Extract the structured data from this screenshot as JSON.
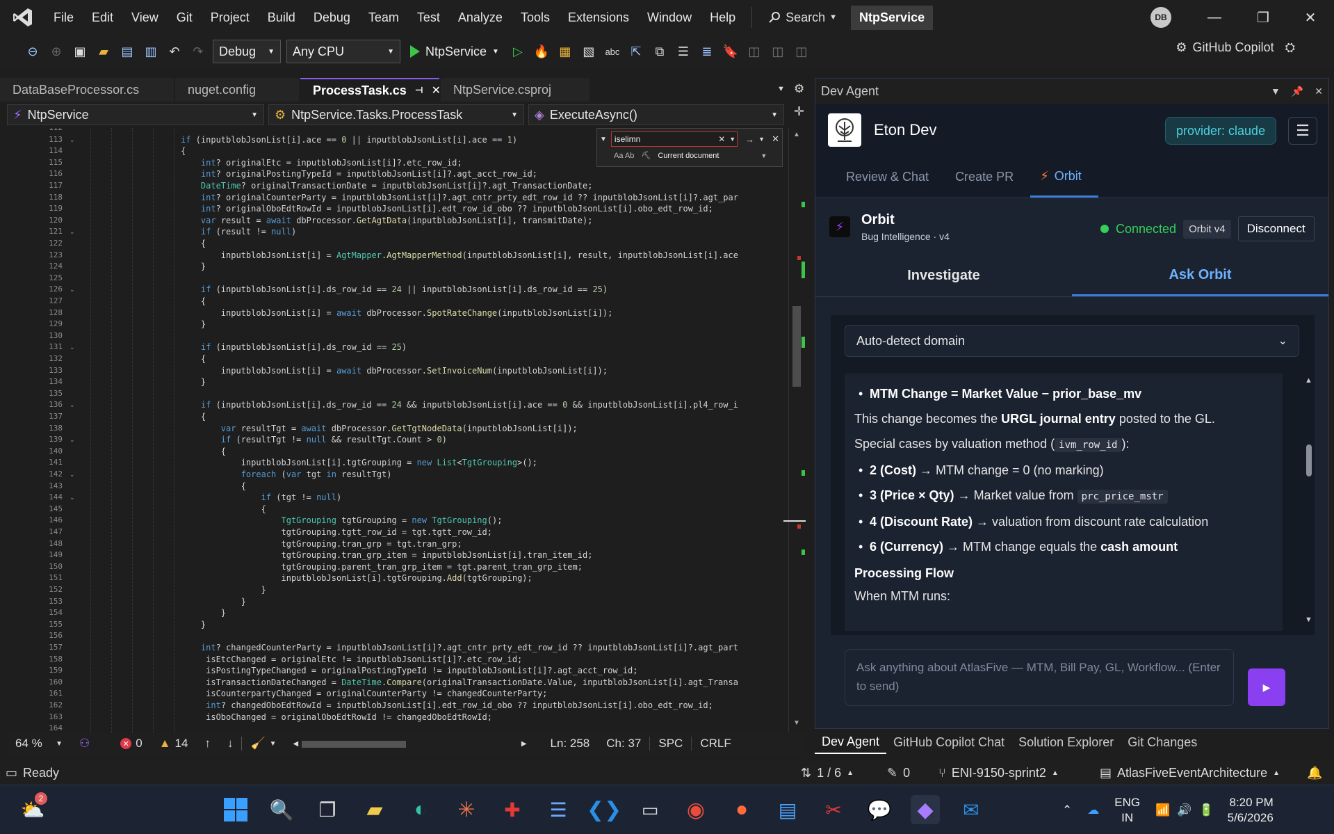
{
  "menu": {
    "items": [
      "File",
      "Edit",
      "View",
      "Git",
      "Project",
      "Build",
      "Debug",
      "Team",
      "Test",
      "Analyze",
      "Tools",
      "Extensions",
      "Window",
      "Help"
    ],
    "search_label": "Search",
    "solution_name": "NtpService",
    "user_initials": "DB"
  },
  "toolbar": {
    "config": "Debug",
    "platform": "Any CPU",
    "run_target": "NtpService",
    "copilot_label": "GitHub Copilot"
  },
  "tabs": [
    {
      "label": "DataBaseProcessor.cs",
      "active": false
    },
    {
      "label": "nuget.config",
      "active": false
    },
    {
      "label": "ProcessTask.cs",
      "active": true
    },
    {
      "label": "NtpService.csproj",
      "active": false
    }
  ],
  "navbar": {
    "project": "NtpService",
    "class": "NtpService.Tasks.ProcessTask",
    "member": "ExecuteAsync()"
  },
  "find": {
    "value": "iselimn",
    "scope": "Current document",
    "options": "Aa  Ab"
  },
  "code": {
    "line_numbers": [
      "112",
      "113",
      "114",
      "115",
      "116",
      "117",
      "118",
      "119",
      "120",
      "121",
      "122",
      "123",
      "124",
      "125",
      "126",
      "127",
      "128",
      "129",
      "130",
      "131",
      "132",
      "133",
      "134",
      "135",
      "136",
      "137",
      "138",
      "139",
      "140",
      "141",
      "142",
      "143",
      "144",
      "145",
      "146",
      "147",
      "148",
      "149",
      "150",
      "151",
      "152",
      "153",
      "154",
      "155",
      "156",
      "157",
      "158",
      "159",
      "160",
      "161",
      "162",
      "163",
      "164"
    ],
    "lines": [
      "",
      "if (inputblobJsonList[i].ace == 0 || inputblobJsonList[i].ace == 1)",
      "{",
      "    int? originalEtc = inputblobJsonList[i]?.etc_row_id;",
      "    int? originalPostingTypeId = inputblobJsonList[i]?.agt_acct_row_id;",
      "    DateTime? originalTransactionDate = inputblobJsonList[i]?.agt_TransactionDate;",
      "    int? originalCounterParty = inputblobJsonList[i]?.agt_cntr_prty_edt_row_id ?? inputblobJsonList[i]?.agt_par",
      "    int? originalOboEdtRowId = inputblobJsonList[i].edt_row_id_obo ?? inputblobJsonList[i].obo_edt_row_id;",
      "    var result = await dbProcessor.GetAgtData(inputblobJsonList[i], transmitDate);",
      "    if (result != null)",
      "    {",
      "        inputblobJsonList[i] = AgtMapper.AgtMapperMethod(inputblobJsonList[i], result, inputblobJsonList[i].ace",
      "    }",
      "",
      "    if (inputblobJsonList[i].ds_row_id == 24 || inputblobJsonList[i].ds_row_id == 25)",
      "    {",
      "        inputblobJsonList[i] = await dbProcessor.SpotRateChange(inputblobJsonList[i]);",
      "    }",
      "",
      "    if (inputblobJsonList[i].ds_row_id == 25)",
      "    {",
      "        inputblobJsonList[i] = await dbProcessor.SetInvoiceNum(inputblobJsonList[i]);",
      "    }",
      "",
      "    if (inputblobJsonList[i].ds_row_id == 24 && inputblobJsonList[i].ace == 0 && inputblobJsonList[i].pl4_row_i",
      "    {",
      "        var resultTgt = await dbProcessor.GetTgtNodeData(inputblobJsonList[i]);",
      "        if (resultTgt != null && resultTgt.Count > 0)",
      "        {",
      "            inputblobJsonList[i].tgtGrouping = new List<TgtGrouping>();",
      "            foreach (var tgt in resultTgt)",
      "            {",
      "                if (tgt != null)",
      "                {",
      "                    TgtGrouping tgtGrouping = new TgtGrouping();",
      "                    tgtGrouping.tgtt_row_id = tgt.tgtt_row_id;",
      "                    tgtGrouping.tran_grp = tgt.tran_grp;",
      "                    tgtGrouping.tran_grp_item = inputblobJsonList[i].tran_item_id;",
      "                    tgtGrouping.parent_tran_grp_item = tgt.parent_tran_grp_item;",
      "                    inputblobJsonList[i].tgtGrouping.Add(tgtGrouping);",
      "                }",
      "            }",
      "        }",
      "    }",
      "",
      "    int? changedCounterParty = inputblobJsonList[i]?.agt_cntr_prty_edt_row_id ?? inputblobJsonList[i]?.agt_part",
      "     isEtcChanged = originalEtc != inputblobJsonList[i]?.etc_row_id;",
      "     isPostingTypeChanged = originalPostingTypeId != inputblobJsonList[i]?.agt_acct_row_id;",
      "     isTransactionDateChanged = DateTime.Compare(originalTransactionDate.Value, inputblobJsonList[i].agt_Transa",
      "     isCounterpartyChanged = originalCounterParty != changedCounterParty;",
      "     int? changedOboEdtRowId = inputblobJsonList[i].edt_row_id_obo ?? inputblobJsonList[i].obo_edt_row_id;",
      "     isOboChanged = originalOboEdtRowId != changedOboEdtRowId;",
      ""
    ]
  },
  "editor_status": {
    "zoom": "64 %",
    "errors": "0",
    "warnings": "14",
    "ln": "Ln: 258",
    "ch": "Ch: 37",
    "spc": "SPC",
    "crlf": "CRLF"
  },
  "dev_agent": {
    "title": "Dev Agent",
    "name": "Eton Dev",
    "provider": "provider: claude",
    "tabs": [
      "Review & Chat",
      "Create PR",
      "Orbit"
    ],
    "orbit": {
      "title": "Orbit",
      "subtitle": "Bug Intelligence · v4",
      "status": "Connected",
      "version": "Orbit v4",
      "disconnect": "Disconnect"
    },
    "sub_tabs": [
      "Investigate",
      "Ask Orbit"
    ],
    "domain": "Auto-detect domain",
    "message": {
      "b1_bold": "MTM Change = Market Value − prior_base_mv",
      "p1_pre": "This change becomes the ",
      "p1_bold": "URGL journal entry",
      "p1_post": " posted to the GL.",
      "p2_pre": "Special cases by valuation method (",
      "p2_code": "ivm_row_id",
      "p2_post": "):",
      "c1_bold": "2 (Cost)",
      "c1_rest": " → MTM change = 0 (no marking)",
      "c2_bold": "3 (Price × Qty)",
      "c2_rest": " → Market value from ",
      "c2_code": "prc_price_mstr",
      "c3_bold": "4 (Discount Rate)",
      "c3_rest": " → valuation from discount rate calculation",
      "c4_bold": "6 (Currency)",
      "c4_rest": " → MTM change equals the ",
      "c4_bold2": "cash amount",
      "h_flow": "Processing Flow",
      "p3": "When MTM runs:"
    },
    "input_placeholder": "Ask anything about AtlasFive — MTM, Bill Pay, GL, Workflow... (Enter to send)"
  },
  "panel_tabs": [
    "Dev Agent",
    "GitHub Copilot Chat",
    "Solution Explorer",
    "Git Changes"
  ],
  "statusbar": {
    "ready": "Ready",
    "lines": "1 / 6",
    "pencil_count": "0",
    "branch": "ENI-9150-sprint2",
    "repo": "AtlasFiveEventArchitecture"
  },
  "taskbar": {
    "weather_badge": "2",
    "lang_top": "ENG",
    "lang_bottom": "IN",
    "time": "8:20 PM",
    "date": "5/6/2026"
  },
  "colors": {
    "accent_purple": "#8a3ff0",
    "connected_green": "#34d058",
    "provider_cyan": "#4fd1e0",
    "active_tab_blue": "#6db2ff"
  }
}
